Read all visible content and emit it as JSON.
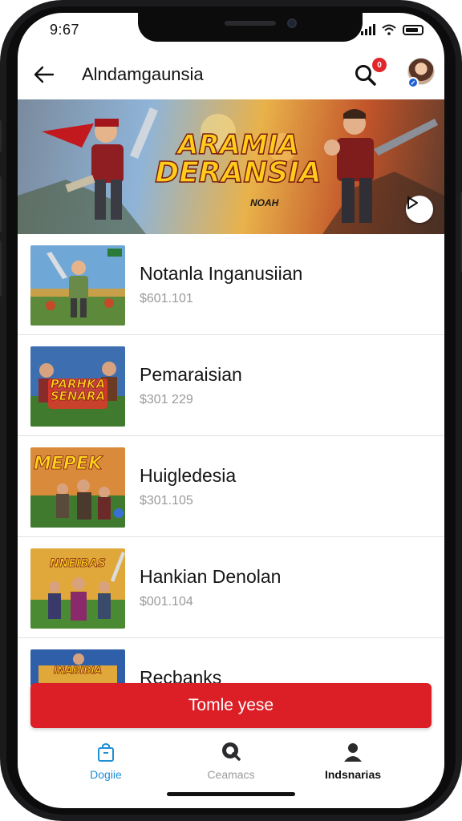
{
  "status": {
    "time": "9:67"
  },
  "appbar": {
    "title": "Alndamgaunsia",
    "notification_count": "0"
  },
  "banner": {
    "title_line1": "ARAMIA",
    "title_line2": "DERANSIA",
    "subtitle": "NOAH"
  },
  "items": [
    {
      "title": "Notanla Inganusiian",
      "price": "$601.101",
      "thumb_text": ""
    },
    {
      "title": "Pemaraisian",
      "price": "$301 229",
      "thumb_text": "PARHKA SENARA"
    },
    {
      "title": "Huigledesia",
      "price": "$301.105",
      "thumb_text": "MEPEK"
    },
    {
      "title": "Hankian Denolan",
      "price": "$001.104",
      "thumb_text": "NNEIBAS"
    },
    {
      "title": "Recbanks",
      "price": "",
      "thumb_text": "INABIBIA"
    }
  ],
  "cta": {
    "label": "Tomle yese"
  },
  "tabs": [
    {
      "label": "Dogiie",
      "icon": "bag-icon"
    },
    {
      "label": "Ceamacs",
      "icon": "search-chat-icon"
    },
    {
      "label": "Indsnarias",
      "icon": "person-icon"
    }
  ],
  "colors": {
    "accent": "#dc1f26",
    "tab_active": "#1f8fd6"
  }
}
